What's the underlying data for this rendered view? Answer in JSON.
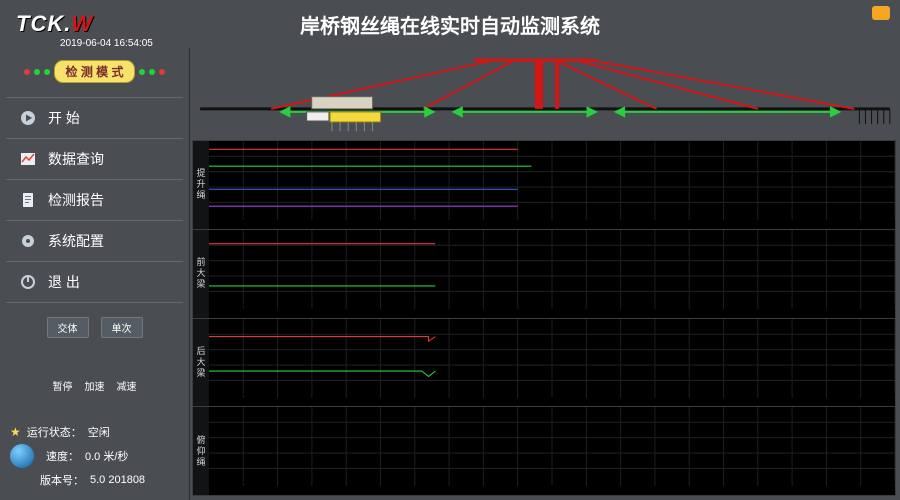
{
  "header": {
    "logo_prefix": "TCK.",
    "logo_suffix": "W",
    "title": "岸桥钢丝绳在线实时自动监测系统",
    "timestamp": "2019-06-04 16:54:05"
  },
  "sidebar": {
    "mode_label": "检 测 模 式",
    "items": [
      {
        "label": "开 始",
        "icon": "play-circle-icon"
      },
      {
        "label": "数据查询",
        "icon": "chart-icon"
      },
      {
        "label": "检测报告",
        "icon": "report-icon"
      },
      {
        "label": "系统配置",
        "icon": "gear-icon"
      },
      {
        "label": "退 出",
        "icon": "power-icon"
      }
    ],
    "small_buttons": {
      "a": "交体",
      "b": "单次"
    },
    "playback": {
      "pause": "暂停",
      "fast": "加速",
      "slow": "减速"
    }
  },
  "status": {
    "run_state_label": "运行状态：",
    "run_state_value": "空闲",
    "speed_label": "速度：",
    "speed_value": "0.0 米/秒",
    "version_label": "版本号：",
    "version_value": "5.0 201808"
  },
  "chart_labels": {
    "a": "提升绳",
    "b": "前大梁",
    "c": "后大梁",
    "d": "俯仰绳"
  },
  "chart_data": [
    {
      "type": "line",
      "xrange": [
        0,
        100
      ],
      "yrange": [
        0,
        1
      ],
      "xticks": [
        5,
        10,
        15,
        20,
        25,
        30,
        35,
        40,
        45,
        50,
        55,
        60,
        65,
        70,
        75,
        80,
        85,
        90,
        95,
        100
      ],
      "series": [
        {
          "name": "红",
          "color": "#e23a3a",
          "x": [
            0,
            45
          ],
          "y": [
            0.92,
            0.92
          ]
        },
        {
          "name": "绿",
          "color": "#26d13b",
          "x": [
            0,
            47
          ],
          "y": [
            0.7,
            0.7
          ]
        },
        {
          "name": "蓝",
          "color": "#3d6df0",
          "x": [
            0,
            45
          ],
          "y": [
            0.4,
            0.4
          ]
        },
        {
          "name": "紫",
          "color": "#a040e0",
          "x": [
            0,
            45
          ],
          "y": [
            0.18,
            0.18
          ]
        }
      ]
    },
    {
      "type": "line",
      "xrange": [
        0,
        100
      ],
      "yrange": [
        0,
        1
      ],
      "xticks": [
        5,
        10,
        15,
        20,
        25,
        30,
        35,
        40,
        45,
        50,
        55,
        60,
        65,
        70,
        75,
        80,
        85,
        90,
        95,
        100
      ],
      "series": [
        {
          "name": "红",
          "color": "#e23a3a",
          "x": [
            0,
            33
          ],
          "y": [
            0.85,
            0.85
          ]
        },
        {
          "name": "绿",
          "color": "#26d13b",
          "x": [
            0,
            33
          ],
          "y": [
            0.3,
            0.3
          ]
        }
      ]
    },
    {
      "type": "line",
      "xrange": [
        0,
        100
      ],
      "yrange": [
        0,
        1
      ],
      "xticks": [
        5,
        10,
        15,
        20,
        25,
        30,
        35,
        40,
        45,
        50,
        55,
        60,
        65,
        70,
        75,
        80,
        85,
        90,
        95,
        100
      ],
      "series": [
        {
          "name": "红",
          "color": "#e23a3a",
          "x": [
            0,
            32,
            32,
            33
          ],
          "y": [
            0.8,
            0.8,
            0.74,
            0.8
          ]
        },
        {
          "name": "绿",
          "color": "#26d13b",
          "x": [
            0,
            31,
            32,
            33
          ],
          "y": [
            0.35,
            0.35,
            0.28,
            0.35
          ]
        }
      ]
    },
    {
      "type": "line",
      "xrange": [
        0,
        100
      ],
      "yrange": [
        0,
        1
      ],
      "xticks": [
        5,
        10,
        15,
        20,
        25,
        30,
        35,
        40,
        45,
        50,
        55,
        60,
        65,
        70,
        75,
        80,
        85,
        90,
        95,
        100
      ],
      "series": []
    }
  ]
}
